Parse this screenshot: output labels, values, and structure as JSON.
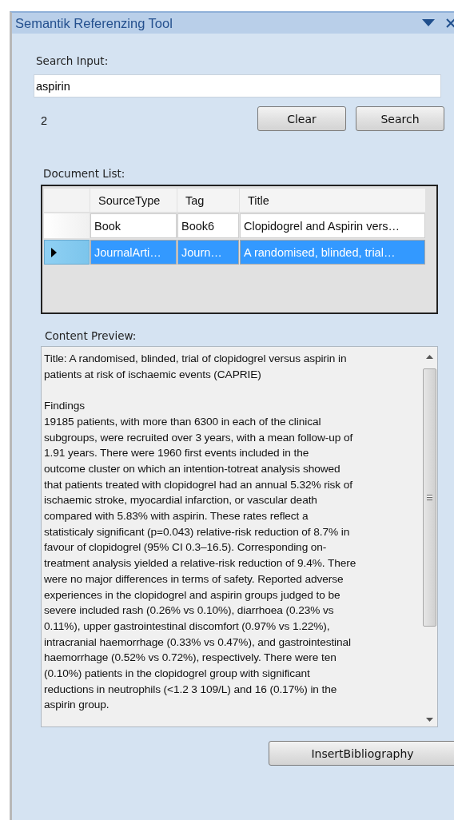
{
  "window": {
    "title": "Semantik Referenzing Tool"
  },
  "search": {
    "label": "Search Input:",
    "value": "aspirin",
    "count": "2",
    "buttons": [
      "Clear",
      "Search"
    ]
  },
  "document_list": {
    "label": "Document List:",
    "columns": [
      "SourceType",
      "Tag",
      "Title"
    ],
    "rows": [
      {
        "cells": [
          "Book",
          "Book6",
          "Clopidogrel and Aspirin vers…"
        ],
        "selected": false
      },
      {
        "cells": [
          "JournalArti…",
          "Journ…",
          "A randomised, blinded, trial…"
        ],
        "selected": true
      }
    ]
  },
  "content_preview": {
    "label": "Content Preview:",
    "text": "Title: A randomised, blinded, trial of clopidogrel versus aspirin in\npatients at risk of ischaemic events (CAPRIE)\n\nFindings\n19185 patients, with more than 6300 in each of the clinical\nsubgroups, were recruited over 3 years, with a mean follow-up of\n1.91 years. There were 1960 first events included in the\noutcome cluster on which an intention-totreat analysis showed\nthat patients treated with clopidogrel had an annual 5.32% risk of\nischaemic stroke, myocardial infarction, or vascular death\ncompared with 5.83% with aspirin. These rates reflect a\nstatisticaly significant (p=0.043) relative-risk reduction of 8.7% in\nfavour of clopidogrel (95% CI 0.3–16.5). Corresponding on-\ntreatment analysis yielded a relative-risk reduction of 9.4%. There\nwere no major differences in terms of safety. Reported adverse\nexperiences in the clopidogrel and aspirin groups judged to be\nsevere included rash (0.26% vs 0.10%), diarrhoea (0.23% vs\n0.11%), upper gastrointestinal discomfort (0.97% vs 1.22%),\nintracranial haemorrhage (0.33% vs 0.47%), and gastrointestinal\nhaemorrhage (0.52% vs 0.72%), respectively. There were ten\n(0.10%) patients in the clopidogrel group with significant\nreductions in neutrophils (<1.2 3 109/L) and 16 (0.17%) in the\naspirin group."
  },
  "buttons": [
    "InsertBibliography"
  ]
}
